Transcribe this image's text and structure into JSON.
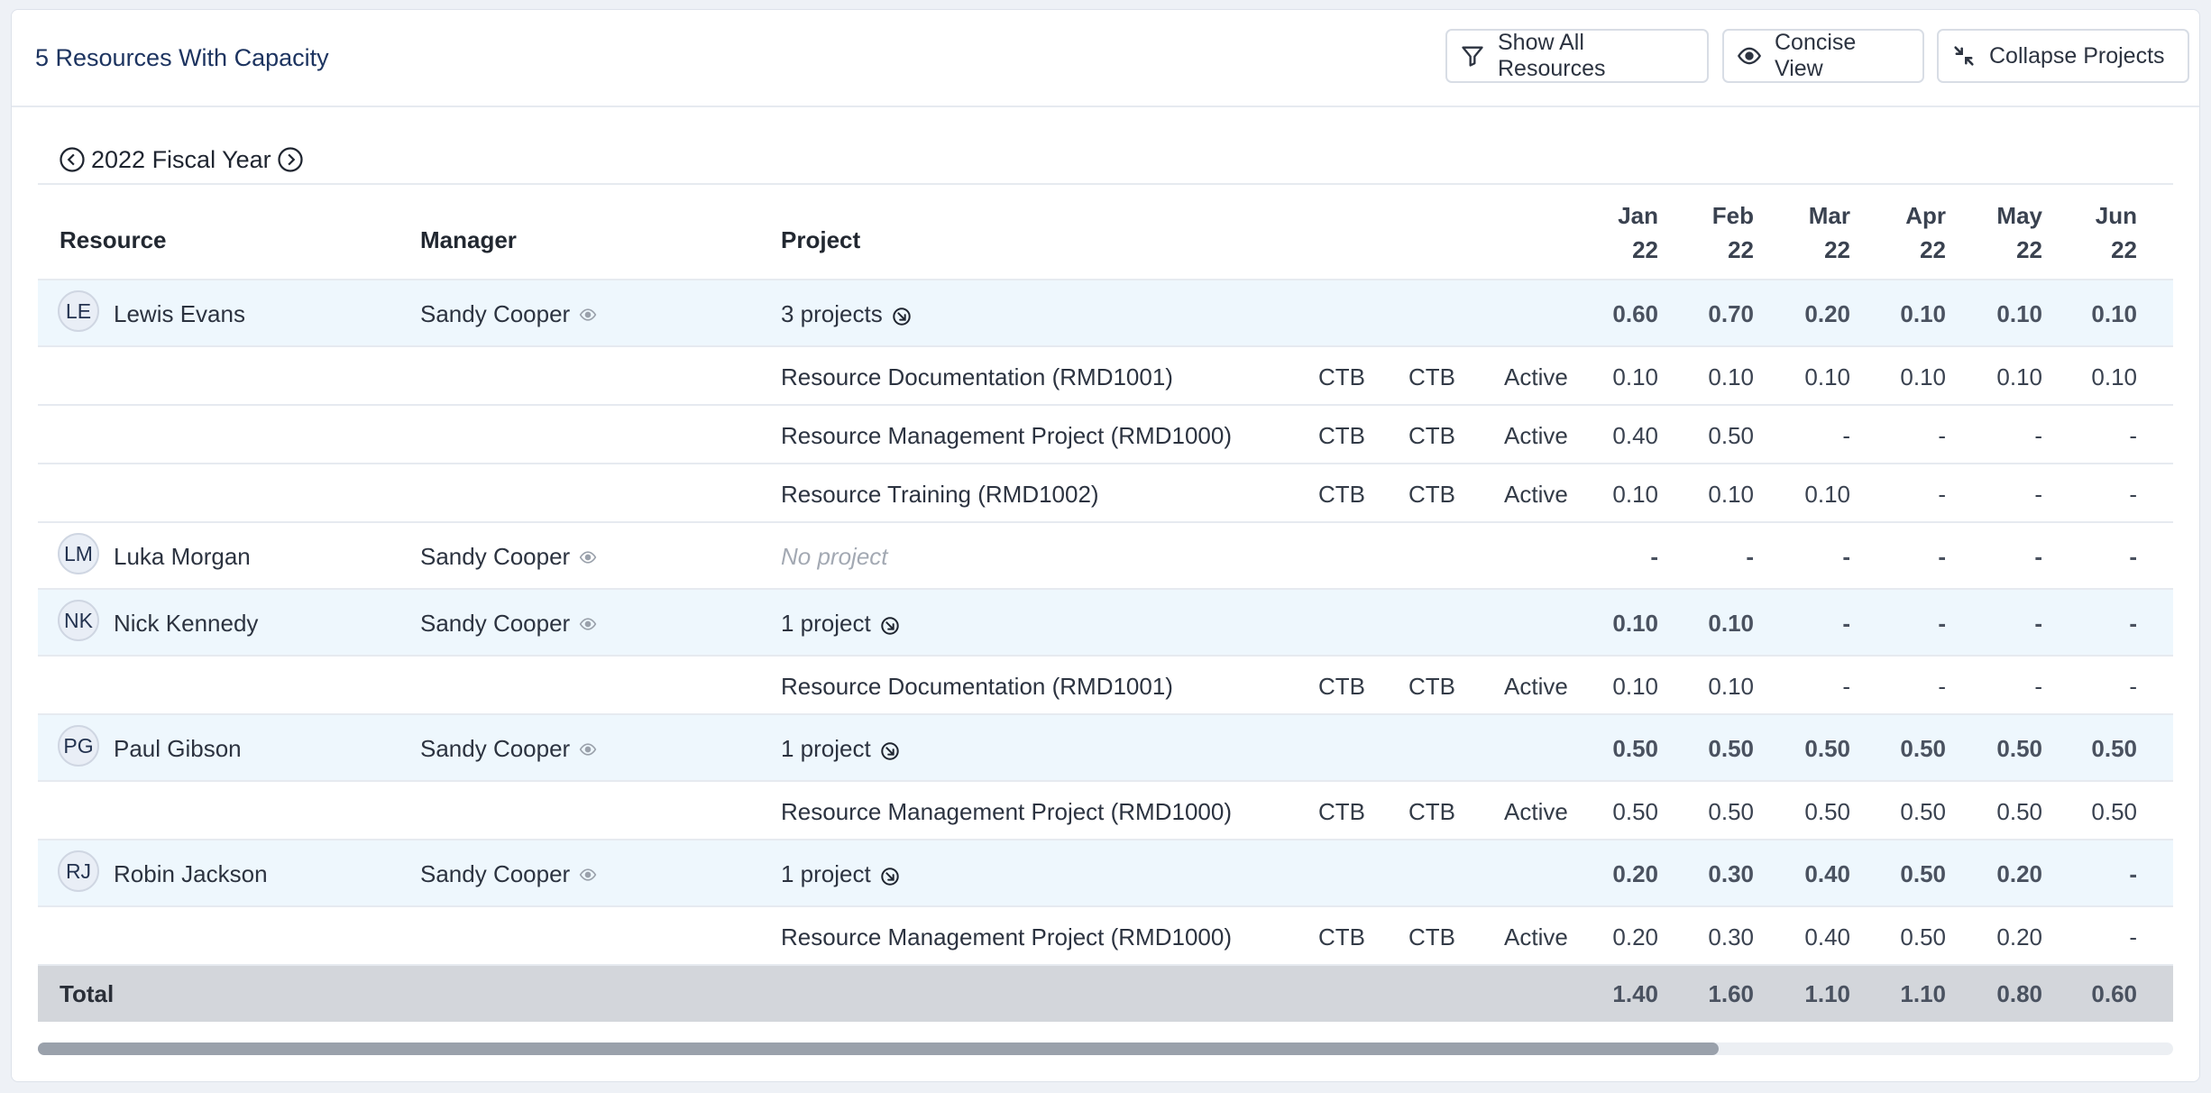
{
  "header": {
    "title": "5 Resources With Capacity",
    "buttons": {
      "show_all": "Show All Resources",
      "concise": "Concise View",
      "collapse": "Collapse Projects"
    }
  },
  "fiscal_year": "2022 Fiscal Year",
  "columns": {
    "resource": "Resource",
    "manager": "Manager",
    "project": "Project",
    "months": [
      {
        "m": "Jan",
        "y": "22"
      },
      {
        "m": "Feb",
        "y": "22"
      },
      {
        "m": "Mar",
        "y": "22"
      },
      {
        "m": "Apr",
        "y": "22"
      },
      {
        "m": "May",
        "y": "22"
      },
      {
        "m": "Jun",
        "y": "22"
      }
    ]
  },
  "rows": [
    {
      "type": "res",
      "initials": "LE",
      "name": "Lewis Evans",
      "manager": "Sandy Cooper",
      "summary": "3 projects",
      "values": [
        "0.60",
        "0.70",
        "0.20",
        "0.10",
        "0.10",
        "0.10"
      ]
    },
    {
      "type": "proj",
      "name": "Resource Documentation (RMD1001)",
      "tag1": "CTB",
      "tag2": "CTB",
      "status": "Active",
      "values": [
        "0.10",
        "0.10",
        "0.10",
        "0.10",
        "0.10",
        "0.10"
      ]
    },
    {
      "type": "proj",
      "name": "Resource Management Project (RMD1000)",
      "tag1": "CTB",
      "tag2": "CTB",
      "status": "Active",
      "values": [
        "0.40",
        "0.50",
        "-",
        "-",
        "-",
        "-"
      ]
    },
    {
      "type": "proj",
      "name": "Resource Training (RMD1002)",
      "tag1": "CTB",
      "tag2": "CTB",
      "status": "Active",
      "values": [
        "0.10",
        "0.10",
        "0.10",
        "-",
        "-",
        "-"
      ]
    },
    {
      "type": "res-none",
      "initials": "LM",
      "name": "Luka Morgan",
      "manager": "Sandy Cooper",
      "summary": "No project",
      "values": [
        "-",
        "-",
        "-",
        "-",
        "-",
        "-"
      ]
    },
    {
      "type": "res",
      "initials": "NK",
      "name": "Nick Kennedy",
      "manager": "Sandy Cooper",
      "summary": "1 project",
      "values": [
        "0.10",
        "0.10",
        "-",
        "-",
        "-",
        "-"
      ]
    },
    {
      "type": "proj",
      "name": "Resource Documentation (RMD1001)",
      "tag1": "CTB",
      "tag2": "CTB",
      "status": "Active",
      "values": [
        "0.10",
        "0.10",
        "-",
        "-",
        "-",
        "-"
      ]
    },
    {
      "type": "res",
      "initials": "PG",
      "name": "Paul Gibson",
      "manager": "Sandy Cooper",
      "summary": "1 project",
      "values": [
        "0.50",
        "0.50",
        "0.50",
        "0.50",
        "0.50",
        "0.50"
      ]
    },
    {
      "type": "proj",
      "name": "Resource Management Project (RMD1000)",
      "tag1": "CTB",
      "tag2": "CTB",
      "status": "Active",
      "values": [
        "0.50",
        "0.50",
        "0.50",
        "0.50",
        "0.50",
        "0.50"
      ]
    },
    {
      "type": "res",
      "initials": "RJ",
      "name": "Robin Jackson",
      "manager": "Sandy Cooper",
      "summary": "1 project",
      "values": [
        "0.20",
        "0.30",
        "0.40",
        "0.50",
        "0.20",
        "-"
      ]
    },
    {
      "type": "proj",
      "name": "Resource Management Project (RMD1000)",
      "tag1": "CTB",
      "tag2": "CTB",
      "status": "Active",
      "values": [
        "0.20",
        "0.30",
        "0.40",
        "0.50",
        "0.20",
        "-"
      ]
    }
  ],
  "total": {
    "label": "Total",
    "values": [
      "1.40",
      "1.60",
      "1.10",
      "1.10",
      "0.80",
      "0.60"
    ]
  },
  "scroll": {
    "position_fraction": 0.787
  },
  "icons": {
    "show_all": "filter-icon",
    "concise": "eye-icon",
    "collapse": "collapse-arrows-icon",
    "prev": "chevron-left-circle-icon",
    "next": "chevron-right-circle-icon",
    "manager": "eye-icon",
    "summary": "arrow-down-right-circle-icon"
  }
}
